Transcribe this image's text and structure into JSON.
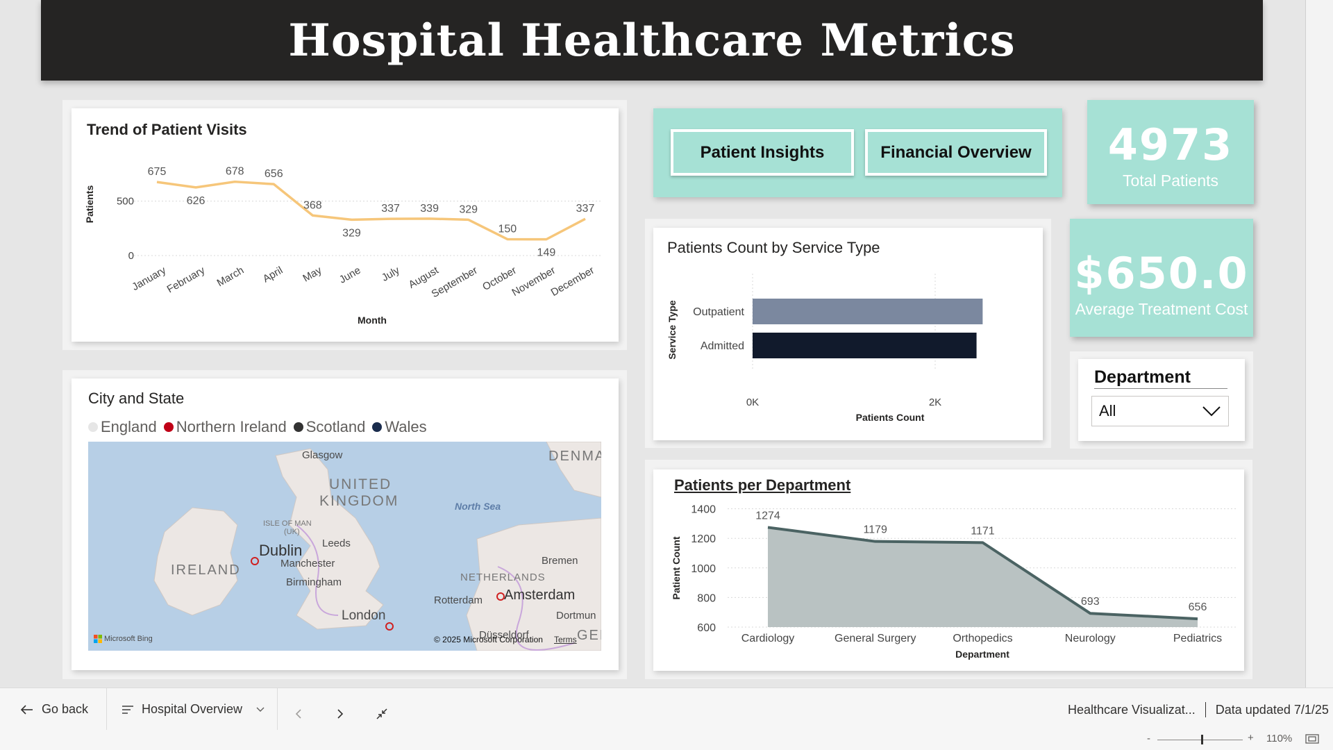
{
  "report": {
    "title": "Hospital Healthcare Metrics"
  },
  "navigation": {
    "patient_insights_label": "Patient Insights",
    "financial_overview_label": "Financial Overview"
  },
  "kpis": {
    "total_patients_value": "4973",
    "total_patients_label": "Total Patients",
    "avg_cost_value": "$650.0",
    "avg_cost_label": "Average Treatment Cost"
  },
  "slicer": {
    "title": "Department",
    "selected": "All",
    "icon": "chevron-down-icon"
  },
  "colors": {
    "header": "#252423",
    "teal": "#a6e1d5",
    "trend_line": "#f6c67a",
    "outpatient_bar": "#7b889f",
    "admitted_bar": "#111a2c",
    "area_fill": "#b9c2c2",
    "area_line": "#4b6363"
  },
  "map": {
    "title": "City and State",
    "legend": [
      {
        "label": "England",
        "color": "#e6e6e6"
      },
      {
        "label": "Northern Ireland",
        "color": "#c00017"
      },
      {
        "label": "Scotland",
        "color": "#333333"
      },
      {
        "label": "Wales",
        "color": "#1a2c4d"
      }
    ],
    "place_labels": {
      "glasgow": "Glasgow",
      "uk_line1": "UNITED",
      "uk_line2": "KINGDOM",
      "north_sea": "North Sea",
      "denmark": "DENMA",
      "isle_of_man_1": "ISLE OF MAN",
      "isle_of_man_2": "(UK)",
      "dublin": "Dublin",
      "leeds": "Leeds",
      "ireland": "IRELAND",
      "manchester": "Manchester",
      "birmingham": "Birmingham",
      "bremen": "Bremen",
      "netherlands": "NETHERLANDS",
      "rotterdam": "Rotterdam",
      "amsterdam": "Amsterdam",
      "dortmund": "Dortmun",
      "london": "London",
      "dusseldorf": "Düsseldorf",
      "germany": "GEF"
    },
    "attribution": "Microsoft Bing",
    "copyright": "© 2025 Microsoft Corporation",
    "terms": "Terms"
  },
  "chart_data": [
    {
      "type": "line",
      "title": "Trend of Patient Visits",
      "xlabel": "Month",
      "ylabel": "Patients",
      "categories": [
        "January",
        "February",
        "March",
        "April",
        "May",
        "June",
        "July",
        "August",
        "September",
        "October",
        "November",
        "December"
      ],
      "values": [
        675,
        626,
        678,
        656,
        368,
        329,
        337,
        339,
        329,
        150,
        149,
        337
      ],
      "y_ticks": [
        "0",
        "500"
      ],
      "ylim": [
        0,
        800
      ],
      "grid": true
    },
    {
      "type": "bar",
      "orientation": "horizontal",
      "title": "Patients Count by Service Type",
      "xlabel": "Patients Count",
      "ylabel": "Service Type",
      "categories": [
        "Outpatient",
        "Admitted"
      ],
      "values": [
        2520,
        2453
      ],
      "x_ticks": [
        "0K",
        "2K"
      ],
      "xlim": [
        0,
        2800
      ],
      "grid": true
    },
    {
      "type": "area",
      "title": "Patients per Department",
      "xlabel": "Department",
      "ylabel": "Patient Count",
      "categories": [
        "Cardiology",
        "General Surgery",
        "Orthopedics",
        "Neurology",
        "Pediatrics"
      ],
      "values": [
        1274,
        1179,
        1171,
        693,
        656
      ],
      "y_ticks": [
        "600",
        "800",
        "1000",
        "1200",
        "1400"
      ],
      "ylim": [
        600,
        1400
      ],
      "grid": true
    }
  ],
  "footer": {
    "go_back": "Go back",
    "page_name": "Hospital Overview",
    "report_name": "Healthcare Visualizat...",
    "data_updated": "Data updated 7/1/25",
    "zoom_minus": "-",
    "zoom_plus": "+",
    "zoom_level": "110%"
  }
}
